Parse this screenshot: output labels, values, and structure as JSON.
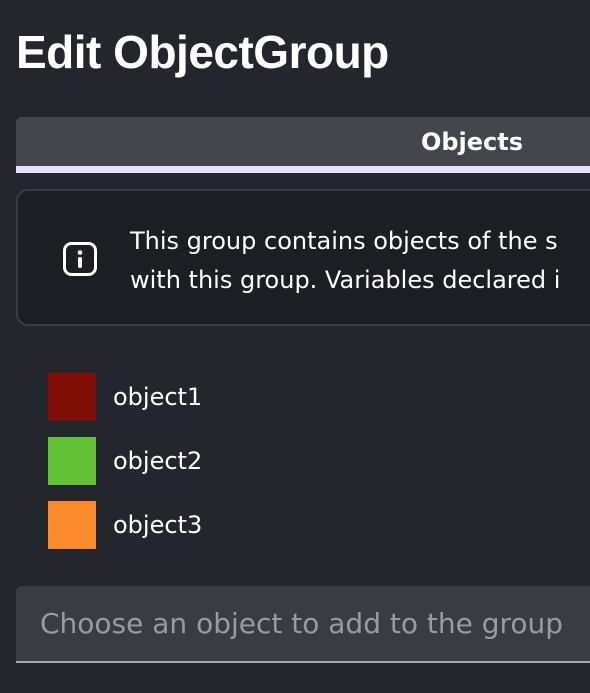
{
  "dialog": {
    "title": "Edit ObjectGroup"
  },
  "tabs": [
    {
      "label": "Objects",
      "selected": true
    }
  ],
  "info": {
    "icon": "info-icon",
    "lines": [
      "This group contains objects of the s",
      "with this group. Variables declared i"
    ]
  },
  "objects": [
    {
      "name": "object1",
      "color": "#7f0f07"
    },
    {
      "name": "object2",
      "color": "#63c138"
    },
    {
      "name": "object3",
      "color": "#fb8a2d"
    }
  ],
  "add_object": {
    "placeholder": "Choose an object to add to the group",
    "value": ""
  },
  "colors": {
    "background": "#25252d",
    "tab_bar": "#45454e",
    "tab_indicator": "#e7e1ff",
    "info_background": "#1d1d24",
    "input_background": "#3b3b43"
  }
}
